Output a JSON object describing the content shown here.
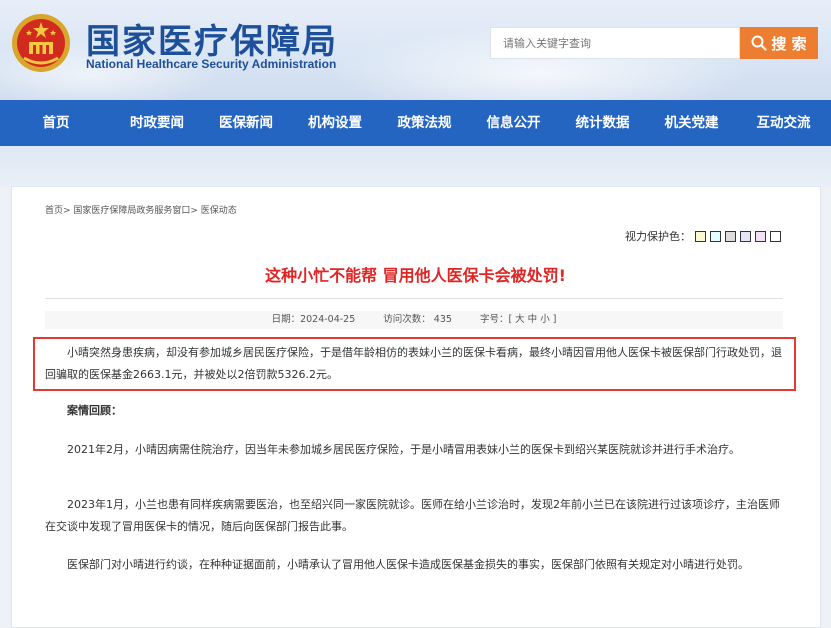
{
  "header": {
    "title_cn": "国家医疗保障局",
    "title_en": "National Healthcare Security Administration",
    "search": {
      "placeholder": "请输入关键字查询",
      "button_label": "搜 索"
    }
  },
  "nav": {
    "items": [
      "首页",
      "时政要闻",
      "医保新闻",
      "机构设置",
      "政策法规",
      "信息公开",
      "统计数据",
      "机关党建",
      "互动交流"
    ]
  },
  "breadcrumb": "首页> 国家医疗保障局政务服务窗口> 医保动态",
  "protect": {
    "label": "视力保护色：",
    "colors": [
      "#fafad2",
      "#e0ffff",
      "#dcdcdc",
      "#e6e6fa",
      "#f5e1f5",
      "#ffffff"
    ]
  },
  "article": {
    "title": "这种小忙不能帮 冒用他人医保卡会被处罚!",
    "date": "日期：2024-04-25",
    "visits": "访问次数：  435",
    "font_size": "字号：[ 大 中 小 ]",
    "summary": "小晴突然身患疾病，却没有参加城乡居民医疗保险，于是借年龄相仿的表妹小兰的医保卡看病，最终小晴因冒用他人医保卡被医保部门行政处罚，退回骗取的医保基金2663.1元，并被处以2倍罚款5326.2元。",
    "section_heading": "案情回顾：",
    "paragraphs": [
      "2021年2月，小晴因病需住院治疗，因当年未参加城乡居民医疗保险，于是小晴冒用表妹小兰的医保卡到绍兴某医院就诊并进行手术治疗。",
      "2023年1月，小兰也患有同样疾病需要医治，也至绍兴同一家医院就诊。医师在给小兰诊治时，发现2年前小兰已在该院进行过该项诊疗，主治医师在交谈中发现了冒用医保卡的情况，随后向医保部门报告此事。",
      "医保部门对小晴进行约谈，在种种证据面前，小晴承认了冒用他人医保卡造成医保基金损失的事实，医保部门依照有关规定对小晴进行处罚。"
    ]
  }
}
